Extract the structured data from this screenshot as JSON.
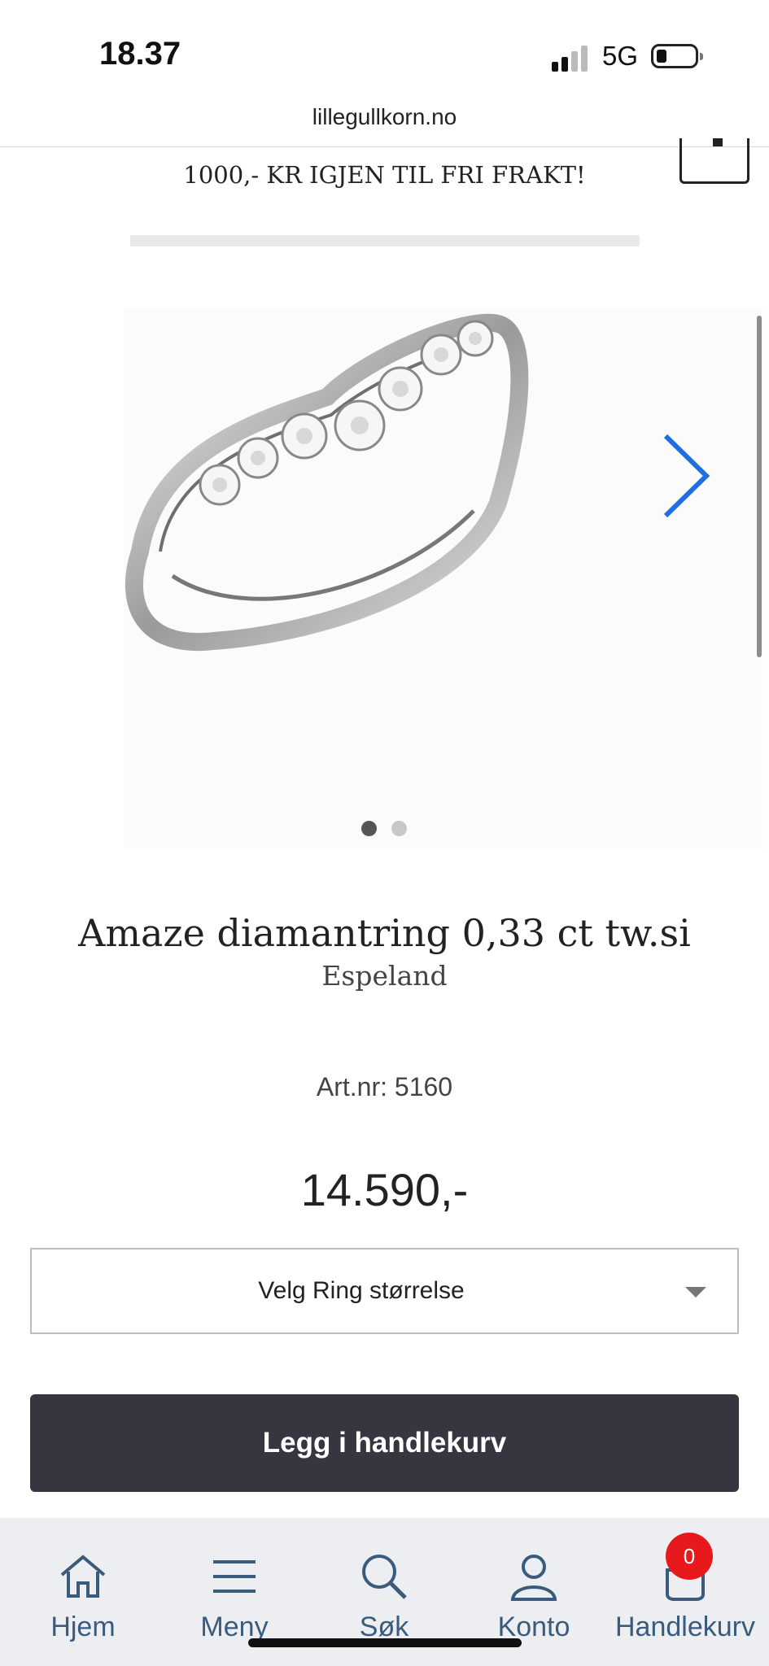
{
  "status_bar": {
    "time": "18.37",
    "network": "5G"
  },
  "browser": {
    "url": "lillegullkorn.no"
  },
  "promo": {
    "text": "1000,- KR IGJEN TIL FRI FRAKT!"
  },
  "gallery": {
    "image_count": 2,
    "active_index": 0,
    "next_icon": "chevron-right-icon"
  },
  "product": {
    "title": "Amaze diamantring 0,33 ct tw.si",
    "brand": "Espeland",
    "article": "Art.nr: 5160",
    "price": "14.590,-"
  },
  "size_select": {
    "label": "Velg Ring størrelse"
  },
  "add_to_cart": {
    "label": "Legg i handlekurv"
  },
  "tabbar": {
    "items": [
      {
        "label": "Hjem",
        "icon": "home-icon"
      },
      {
        "label": "Meny",
        "icon": "menu-icon"
      },
      {
        "label": "Søk",
        "icon": "search-icon"
      },
      {
        "label": "Konto",
        "icon": "user-icon"
      },
      {
        "label": "Handlekurv",
        "icon": "cart-icon"
      }
    ],
    "cart_count": "0"
  },
  "colors": {
    "button_bg": "#383440",
    "nav_text": "#3b5b7c",
    "badge": "#e8191c",
    "arrow": "#1e6fe0"
  }
}
